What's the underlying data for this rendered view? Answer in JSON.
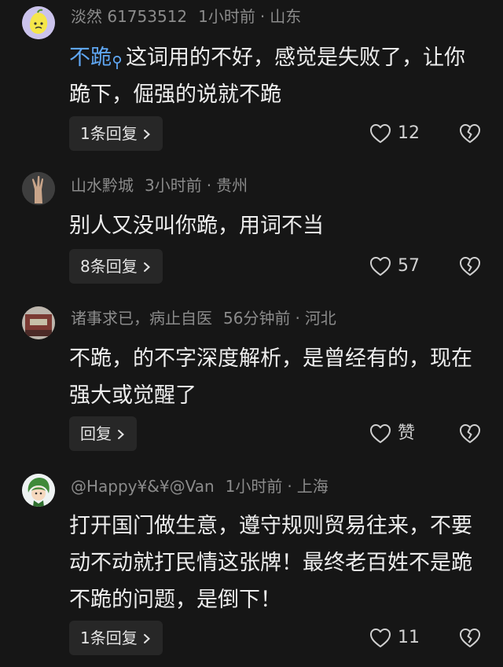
{
  "comments": [
    {
      "user": "淡然 61753512",
      "time": "1小时前",
      "location": "山东",
      "link_text": "不跪",
      "text": "这词用的不好，感觉是失败了，让你跪下，倔强的说就不跪",
      "reply_label": "1条回复",
      "likes": "12"
    },
    {
      "user": "山水黔城",
      "time": "3小时前",
      "location": "贵州",
      "text": "别人又没叫你跪，用词不当",
      "reply_label": "8条回复",
      "likes": "57"
    },
    {
      "user": "诸事求已，病止自医",
      "time": "56分钟前",
      "location": "河北",
      "text": "不跪，的不字深度解析，是曾经有的，现在强大或觉醒了",
      "reply_label": "回复",
      "likes": "赞"
    },
    {
      "user": "@Happy¥&¥@Van",
      "time": "1小时前",
      "location": "上海",
      "text": "打开国门做生意，遵守规则贸易往来，不要动不动就打民情这张牌！最终老百姓不是跪不跪的问题，是倒下！",
      "reply_label": "1条回复",
      "likes": "11"
    }
  ],
  "separator": "·",
  "colors": {
    "background": "#161616",
    "text": "#ededed",
    "meta": "#8b8b8b",
    "link": "#5fa6f2",
    "button_bg": "#272727"
  }
}
